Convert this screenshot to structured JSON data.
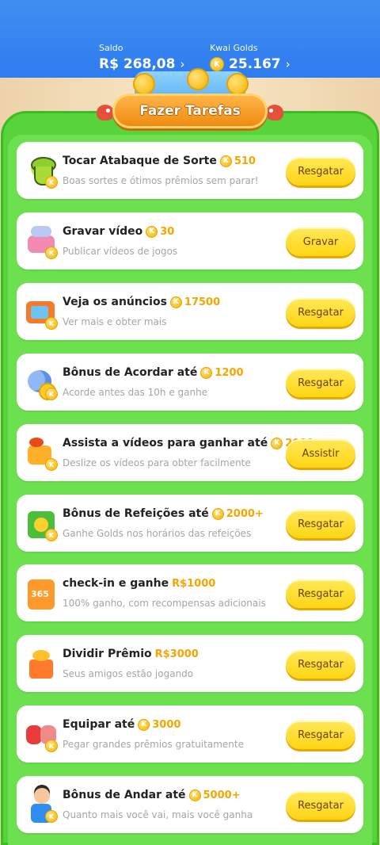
{
  "header": {
    "saldo_label": "Saldo",
    "saldo_value": "R$ 268,08",
    "golds_label": "Kwai Golds",
    "golds_value": "25.167",
    "chevron": "›"
  },
  "banner": {
    "title": "Fazer Tarefas"
  },
  "coin_glyph": "K",
  "tasks": [
    {
      "title": "Tocar Atabaque de Sorte",
      "reward": "510",
      "reward_coin": true,
      "subtitle": "Boas sortes e ótimos prêmios sem parar!",
      "button": "Resgatar",
      "icon": "drum-icon"
    },
    {
      "title": "Gravar vídeo",
      "reward": "30",
      "reward_coin": true,
      "subtitle": "Publicar vídeos de jogos",
      "button": "Gravar",
      "icon": "video-record-icon"
    },
    {
      "title": "Veja os anúncios",
      "reward": "17500",
      "reward_coin": true,
      "subtitle": "Ver mais e obter mais",
      "button": "Resgatar",
      "icon": "tv-ad-icon"
    },
    {
      "title": "Bônus de Acordar até",
      "reward": "1200",
      "reward_coin": true,
      "subtitle": "Acorde antes das 10h e ganhe",
      "button": "Resgatar",
      "icon": "moon-wake-icon"
    },
    {
      "title": "Assista a vídeos para ganhar até",
      "reward": "2000",
      "reward_coin": true,
      "subtitle": "Deslize os vídeos para obter facilmente",
      "button": "Assistir",
      "icon": "camera-icon"
    },
    {
      "title": "Bônus de Refeições até",
      "reward": "2000+",
      "reward_coin": true,
      "subtitle": "Ganhe Golds nos horários das refeições",
      "button": "Resgatar",
      "icon": "meal-calendar-icon"
    },
    {
      "title": "check-in e ganhe",
      "reward": "R$1000",
      "reward_coin": false,
      "subtitle": "100% ganho, com recompensas adicionais",
      "button": "Resgatar",
      "icon": "calendar-365-icon"
    },
    {
      "title": "Dividir Prêmio",
      "reward": "R$3000",
      "reward_coin": false,
      "subtitle": "Seus amigos estão jogando",
      "button": "Resgatar",
      "icon": "gift-icon"
    },
    {
      "title": "Equipar até",
      "reward": "3000",
      "reward_coin": true,
      "subtitle": "Pegar grandes prêmios gratuitamente",
      "button": "Resgatar",
      "icon": "boxing-glove-icon"
    },
    {
      "title": "Bônus de Andar até",
      "reward": "5000+",
      "reward_coin": true,
      "subtitle": "Quanto mais você vai, mais você ganha",
      "button": "Resgatar",
      "icon": "walking-person-icon"
    }
  ]
}
